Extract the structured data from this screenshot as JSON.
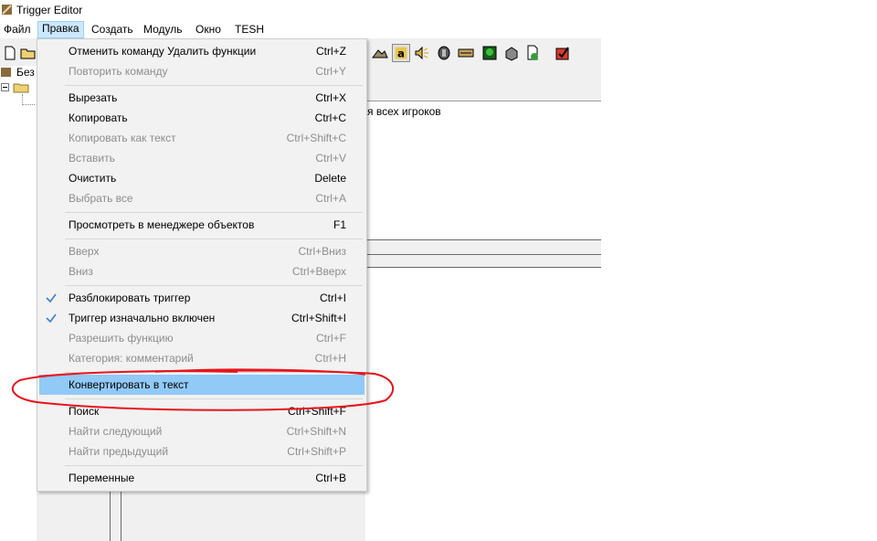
{
  "window": {
    "title": "Trigger Editor"
  },
  "menubar": {
    "items": [
      "Файл",
      "Правка",
      "Создать",
      "Модуль",
      "Окно",
      "TESH"
    ],
    "active_index": 1
  },
  "tree": {
    "root_label": "Без"
  },
  "right_pane": {
    "text": "я всех игроков"
  },
  "edit_menu": {
    "items": [
      {
        "label": "Отменить команду Удалить функции",
        "shortcut": "Ctrl+Z",
        "enabled": true
      },
      {
        "label": "Повторить команду",
        "shortcut": "Ctrl+Y",
        "enabled": false
      },
      {
        "label": "Вырезать",
        "shortcut": "Ctrl+X",
        "enabled": true
      },
      {
        "label": "Копировать",
        "shortcut": "Ctrl+C",
        "enabled": true
      },
      {
        "label": "Копировать как текст",
        "shortcut": "Ctrl+Shift+C",
        "enabled": false
      },
      {
        "label": "Вставить",
        "shortcut": "Ctrl+V",
        "enabled": false
      },
      {
        "label": "Очистить",
        "shortcut": "Delete",
        "enabled": true
      },
      {
        "label": "Выбрать все",
        "shortcut": "Ctrl+A",
        "enabled": false
      },
      {
        "label": "Просмотреть в менеджере объектов",
        "shortcut": "F1",
        "enabled": true
      },
      {
        "label": "Вверх",
        "shortcut": "Ctrl+Вниз",
        "enabled": false
      },
      {
        "label": "Вниз",
        "shortcut": "Ctrl+Вверх",
        "enabled": false
      },
      {
        "label": "Разблокировать триггер",
        "shortcut": "Ctrl+I",
        "enabled": true,
        "checked": true
      },
      {
        "label": "Триггер изначально включен",
        "shortcut": "Ctrl+Shift+I",
        "enabled": true,
        "checked": true
      },
      {
        "label": "Разрешить функцию",
        "shortcut": "Ctrl+F",
        "enabled": false
      },
      {
        "label": "Категория: комментарий",
        "shortcut": "Ctrl+H",
        "enabled": false
      },
      {
        "label": "Конвертировать в текст",
        "shortcut": "",
        "enabled": true,
        "highlighted": true
      },
      {
        "label": "Поиск",
        "shortcut": "Ctrl+Shift+F",
        "enabled": true
      },
      {
        "label": "Найти следующий",
        "shortcut": "Ctrl+Shift+N",
        "enabled": false
      },
      {
        "label": "Найти предыдущий",
        "shortcut": "Ctrl+Shift+P",
        "enabled": false
      },
      {
        "label": "Переменные",
        "shortcut": "Ctrl+B",
        "enabled": true
      }
    ]
  },
  "annotation": {
    "color": "#e8141c",
    "target": "Конвертировать в текст"
  },
  "colors": {
    "highlight": "#91c9f7",
    "disabled_text": "#8d8d8d",
    "menu_bg": "#f2f2f2",
    "check": "#3a7fd6"
  }
}
